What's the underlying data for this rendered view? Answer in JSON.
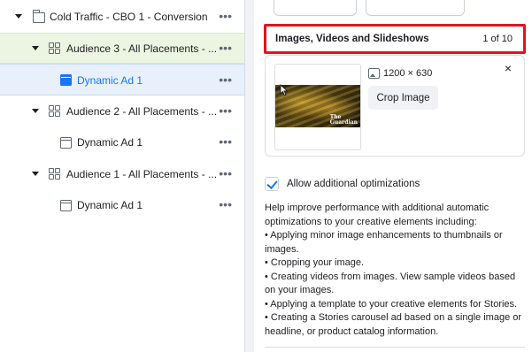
{
  "tree": {
    "rows": [
      {
        "label": "Cold Traffic - CBO 1 - Conversion",
        "type": "campaign"
      },
      {
        "label": "Audience 3 - All Placements - ...",
        "type": "adset",
        "selected": "green"
      },
      {
        "label": "Dynamic Ad 1",
        "type": "ad",
        "selected": "blue"
      },
      {
        "label": "Audience 2 - All Placements - ...",
        "type": "adset"
      },
      {
        "label": "Dynamic Ad 1",
        "type": "ad"
      },
      {
        "label": "Audience 1 - All Placements - ...",
        "type": "adset"
      },
      {
        "label": "Dynamic Ad 1",
        "type": "ad"
      }
    ],
    "more_label": "•••"
  },
  "section": {
    "title": "Images, Videos and Slideshows",
    "count": "1 of 10"
  },
  "media": {
    "dimensions": "1200 × 630",
    "crop_label": "Crop Image",
    "close_label": "×",
    "logo_text": "The Guardian"
  },
  "optimizations": {
    "checkbox_label": "Allow additional optimizations",
    "checked": true,
    "intro": "Help improve performance with additional automatic optimizations to your creative elements including:",
    "bullets": [
      "• Applying minor image enhancements to thumbnails or images.",
      "• Cropping your image.",
      "• Creating videos from images. View sample videos based on your images.",
      "• Applying a template to your creative elements for Stories.",
      "• Creating a Stories carousel ad based on a single image or headline, or product catalog information."
    ]
  },
  "colors": {
    "highlight_border": "#e0141e",
    "accent": "#1877f2",
    "selected_adset_bg": "#ecf5e1",
    "selected_ad_bg": "#e7f0fb"
  },
  "icons": {
    "campaign": "folder-icon",
    "adset": "grid-icon",
    "ad": "ad-icon",
    "expand": "caret-down-icon",
    "more": "more-dots-icon",
    "dimensions": "image-icon",
    "close": "close-icon",
    "cursor": "cursor-icon"
  }
}
